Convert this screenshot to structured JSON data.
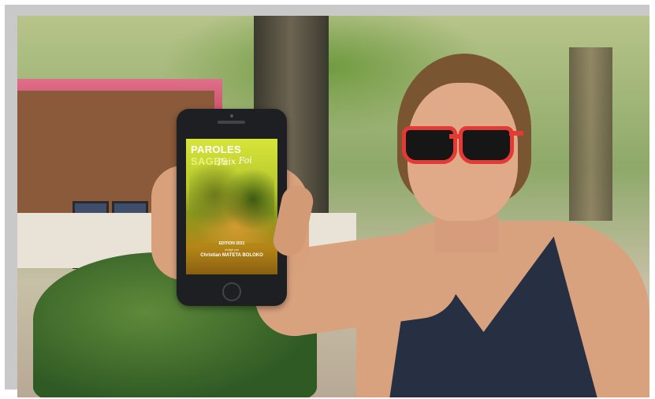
{
  "phone_screen": {
    "title_part1": "PAROLES",
    "title_part2": "SAGES",
    "script_text": "Paix Foi",
    "edition": "EDITION 2021",
    "written_by": "rédigé par",
    "author": "Christian MATETA BOLOKO"
  },
  "colors": {
    "frame": "#c9c9c9",
    "sunglasses": "#e43a35",
    "screen_top": "#d7e43a",
    "screen_bottom": "#8a5f10"
  }
}
